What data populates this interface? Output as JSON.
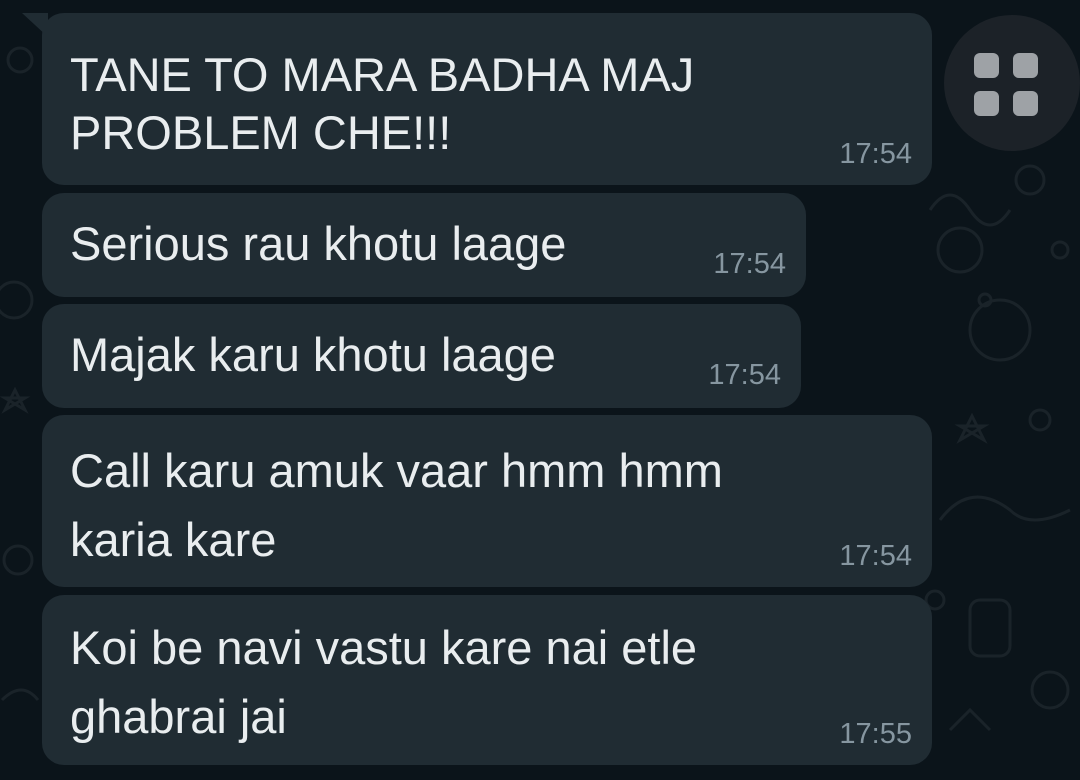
{
  "messages": [
    {
      "text_lines": [
        "TANE TO MARA BADHA MAJ",
        "PROBLEM CHE!!!"
      ],
      "time": "17:54"
    },
    {
      "text_lines": [
        "Serious rau khotu laage"
      ],
      "time": "17:54"
    },
    {
      "text_lines": [
        "Majak karu khotu laage"
      ],
      "time": "17:54"
    },
    {
      "text_lines": [
        "Call karu amuk vaar hmm hmm",
        "karia kare"
      ],
      "time": "17:54"
    },
    {
      "text_lines": [
        "Koi be navi vastu kare nai etle",
        "ghabrai jai"
      ],
      "time": "17:55"
    }
  ],
  "overlay_button": {
    "icon": "grid-icon"
  },
  "colors": {
    "background": "#0b141a",
    "bubble": "#202c33",
    "text": "#e9edef",
    "timestamp": "#8696a0"
  }
}
